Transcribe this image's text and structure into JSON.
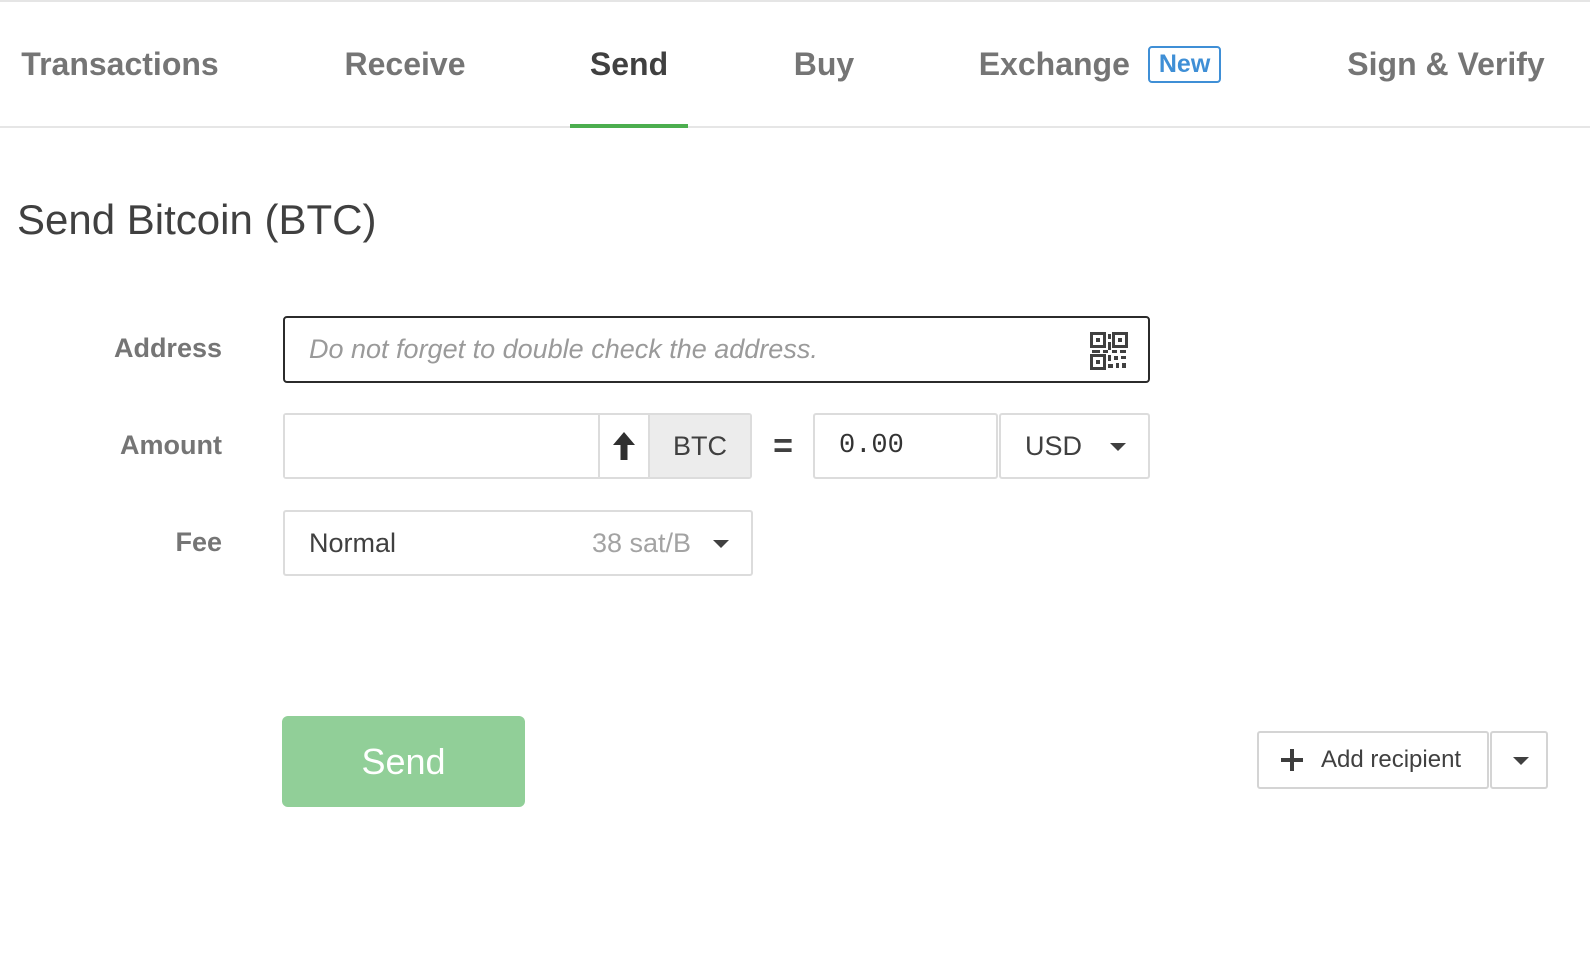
{
  "tabs": [
    {
      "label": "Transactions",
      "active": false
    },
    {
      "label": "Receive",
      "active": false
    },
    {
      "label": "Send",
      "active": true
    },
    {
      "label": "Buy",
      "active": false
    },
    {
      "label": "Exchange",
      "active": false,
      "badge": "New"
    },
    {
      "label": "Sign & Verify",
      "active": false
    }
  ],
  "page": {
    "title": "Send Bitcoin (BTC)"
  },
  "form": {
    "address": {
      "label": "Address",
      "value": "",
      "placeholder": "Do not forget to double check the address.",
      "icon": "qr-code-icon"
    },
    "amount": {
      "label": "Amount",
      "value": "",
      "icon": "arrow-up-icon",
      "unit": "BTC",
      "equals": "=",
      "fiat_value": "0.00",
      "currency": "USD"
    },
    "fee": {
      "label": "Fee",
      "level": "Normal",
      "rate": "38 sat/B"
    }
  },
  "actions": {
    "send_label": "Send",
    "add_recipient_label": "Add recipient",
    "add_recipient_icon": "plus-icon"
  },
  "colors": {
    "accent": "#4cae4f",
    "send_button": "#91cf98",
    "badge": "#3f8fd6"
  }
}
